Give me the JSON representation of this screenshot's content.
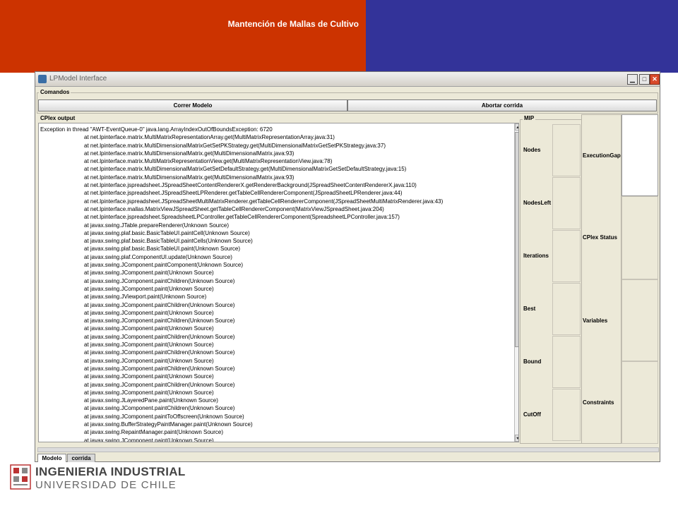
{
  "slide": {
    "title": "Mantención de Mallas de Cultivo",
    "colors": {
      "red_band": "#cc3300",
      "blue_band": "#333399"
    }
  },
  "window": {
    "title": "LPModel Interface",
    "controls": {
      "minimize": "▁",
      "maximize": "□",
      "close": "✕"
    }
  },
  "commands": {
    "label": "Comandos",
    "run_label": "Correr Modelo",
    "abort_label": "Abortar corrida"
  },
  "output": {
    "label": "CPlex output",
    "lines": [
      "Exception in thread \"AWT-EventQueue-0\" java.lang.ArrayIndexOutOfBoundsException: 6720",
      "at net.lpinterface.matrix.MultiMatrixRepresentationArray.get(MultiMatrixRepresentationArray.java:31)",
      "at net.lpinterface.matrix.MultiDimensionalMatrixGetSetPKStrategy.get(MultiDimensionalMatrixGetSetPKStrategy.java:37)",
      "at net.lpinterface.matrix.MultiDimensionalMatrix.get(MultiDimensionalMatrix.java:93)",
      "at net.lpinterface.matrix.MultiMatrixRepresentationView.get(MultiMatrixRepresentationView.java:78)",
      "at net.lpinterface.matrix.MultiDimensionalMatrixGetSetDefaultStrategy.get(MultiDimensionalMatrixGetSetDefaultStrategy.java:15)",
      "at net.lpinterface.matrix.MultiDimensionalMatrix.get(MultiDimensionalMatrix.java:93)",
      "at net.lpinterface.jspreadsheet.JSpreadSheetContentRendererX.getRendererBackground(JSpreadSheetContentRendererX.java:110)",
      "at net.lpinterface.jspreadsheet.JSpreadSheetLPRenderer.getTableCellRendererComponent(JSpreadSheetLPRenderer.java:44)",
      "at net.lpinterface.jspreadsheet.JSpreadSheetMultiMatrixRenderer.getTableCellRendererComponent(JSpreadSheetMultiMatrixRenderer.java:43)",
      "at net.lpinterface.mallas.MatrixViewJSpreadSheet.getTableCellRendererComponent(MatrixViewJSpreadSheet.java:204)",
      "at net.lpinterface.jspreadsheet.SpreadsheetLPController.getTableCellRendererComponent(SpreadsheetLPController.java:157)",
      "at javax.swing.JTable.prepareRenderer(Unknown Source)",
      "at javax.swing.plaf.basic.BasicTableUI.paintCell(Unknown Source)",
      "at javax.swing.plaf.basic.BasicTableUI.paintCells(Unknown Source)",
      "at javax.swing.plaf.basic.BasicTableUI.paint(Unknown Source)",
      "at javax.swing.plaf.ComponentUI.update(Unknown Source)",
      "at javax.swing.JComponent.paintComponent(Unknown Source)",
      "at javax.swing.JComponent.paint(Unknown Source)",
      "at javax.swing.JComponent.paintChildren(Unknown Source)",
      "at javax.swing.JComponent.paint(Unknown Source)",
      "at javax.swing.JViewport.paint(Unknown Source)",
      "at javax.swing.JComponent.paintChildren(Unknown Source)",
      "at javax.swing.JComponent.paint(Unknown Source)",
      "at javax.swing.JComponent.paintChildren(Unknown Source)",
      "at javax.swing.JComponent.paint(Unknown Source)",
      "at javax.swing.JComponent.paintChildren(Unknown Source)",
      "at javax.swing.JComponent.paint(Unknown Source)",
      "at javax.swing.JComponent.paintChildren(Unknown Source)",
      "at javax.swing.JComponent.paint(Unknown Source)",
      "at javax.swing.JComponent.paintChildren(Unknown Source)",
      "at javax.swing.JComponent.paint(Unknown Source)",
      "at javax.swing.JComponent.paintChildren(Unknown Source)",
      "at javax.swing.JComponent.paint(Unknown Source)",
      "at javax.swing.JLayeredPane.paint(Unknown Source)",
      "at javax.swing.JComponent.paintChildren(Unknown Source)",
      "at javax.swing.JComponent.paintToOffscreen(Unknown Source)",
      "at javax.swing.BufferStrategyPaintManager.paint(Unknown Source)",
      "at javax.swing.RepaintManager.paint(Unknown Source)",
      "at javax.swing.JComponent.paint(Unknown Source)",
      "at java.awt.GraphicsCallback$PaintCallback.run(Unknown Source)"
    ]
  },
  "mip": {
    "label": "MIP",
    "fields": [
      "Nodes",
      "NodesLeft",
      "Iterations",
      "Best",
      "Bound",
      "CutOff"
    ]
  },
  "status": {
    "fields": [
      "ExecutionGap",
      "CPlex Status",
      "Variables",
      "Constraints"
    ]
  },
  "tabs": [
    {
      "label": "Modelo",
      "active": true
    },
    {
      "label": "corrida",
      "active": false
    }
  ],
  "logo": {
    "line1": "INGENIERIA INDUSTRIAL",
    "line2": "UNIVERSIDAD DE CHILE"
  }
}
